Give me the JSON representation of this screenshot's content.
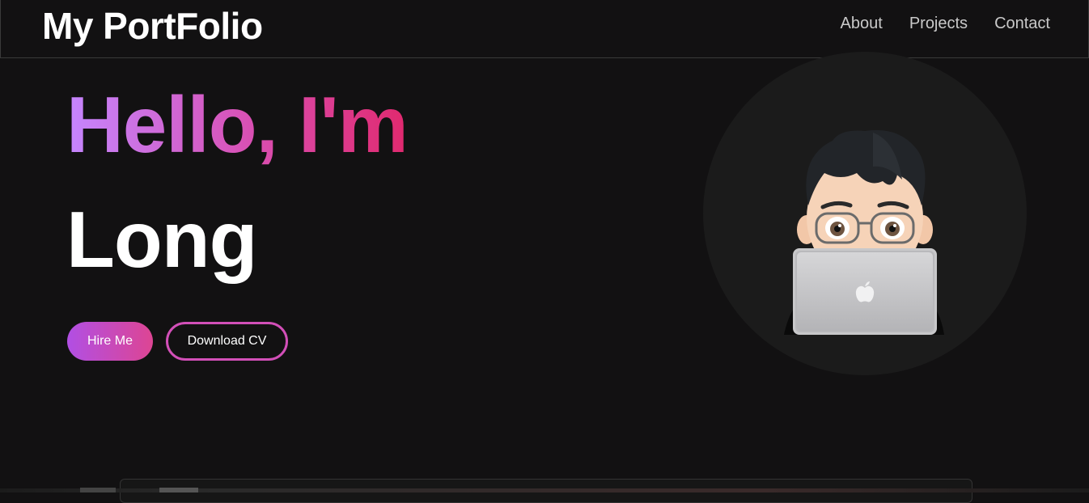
{
  "header": {
    "brand": "My PortFolio",
    "nav": [
      {
        "label": "About"
      },
      {
        "label": "Projects"
      },
      {
        "label": "Contact"
      }
    ]
  },
  "hero": {
    "greeting": "Hello, I'm",
    "name": "Long",
    "hire_label": "Hire Me",
    "cv_label": "Download CV"
  },
  "colors": {
    "background": "#121112",
    "gradient_start": "#c586ff",
    "gradient_end": "#e0296e",
    "nav_text": "#c9c9c9"
  },
  "icons": {
    "avatar": "memoji-with-laptop-icon",
    "laptop_logo": "apple-logo-icon"
  }
}
